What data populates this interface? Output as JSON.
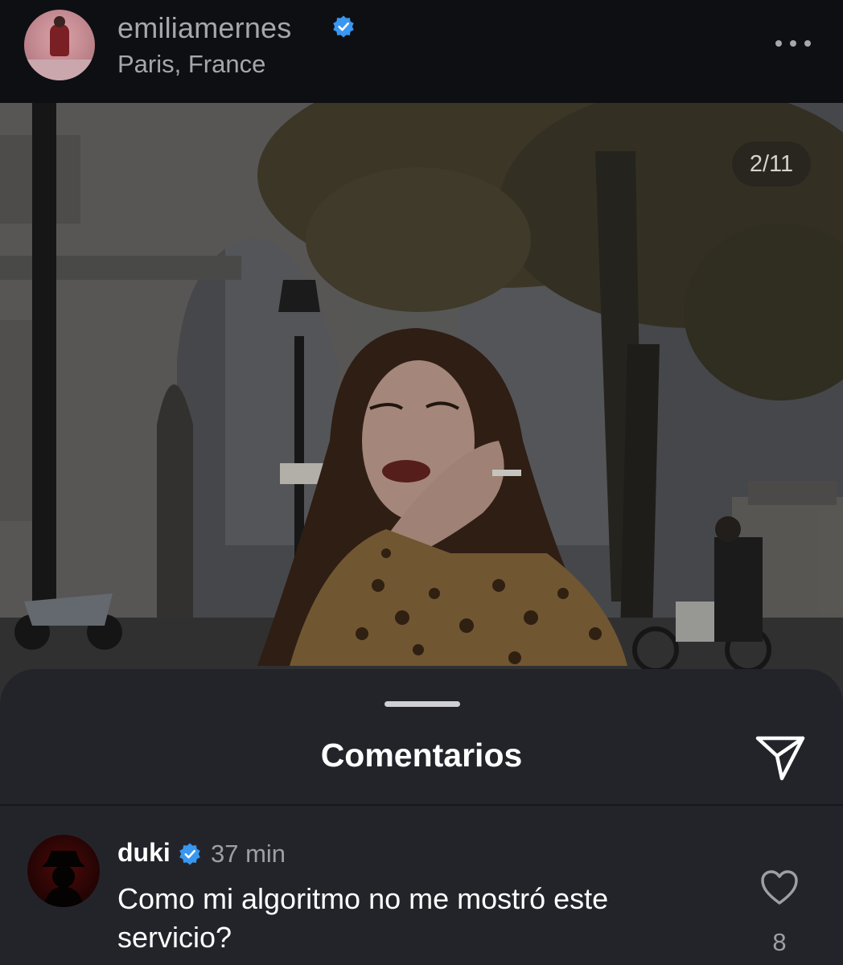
{
  "header": {
    "username": "emiliamernes",
    "location": "Paris, France",
    "verified": true
  },
  "photo": {
    "counter": "2/11"
  },
  "sheet": {
    "title": "Comentarios"
  },
  "comment": {
    "username": "duki",
    "verified": true,
    "time": "37 min",
    "text": "Como mi algoritmo no me mostró este servicio?",
    "likes": "8"
  },
  "colors": {
    "verified_blue": "#3897f0",
    "sheet_bg": "#23242a",
    "header_bg": "#0e0f13"
  },
  "icons": {
    "more": "more-horizontal-icon",
    "share": "paper-plane-icon",
    "like": "heart-outline-icon",
    "verified": "verified-badge-icon"
  }
}
